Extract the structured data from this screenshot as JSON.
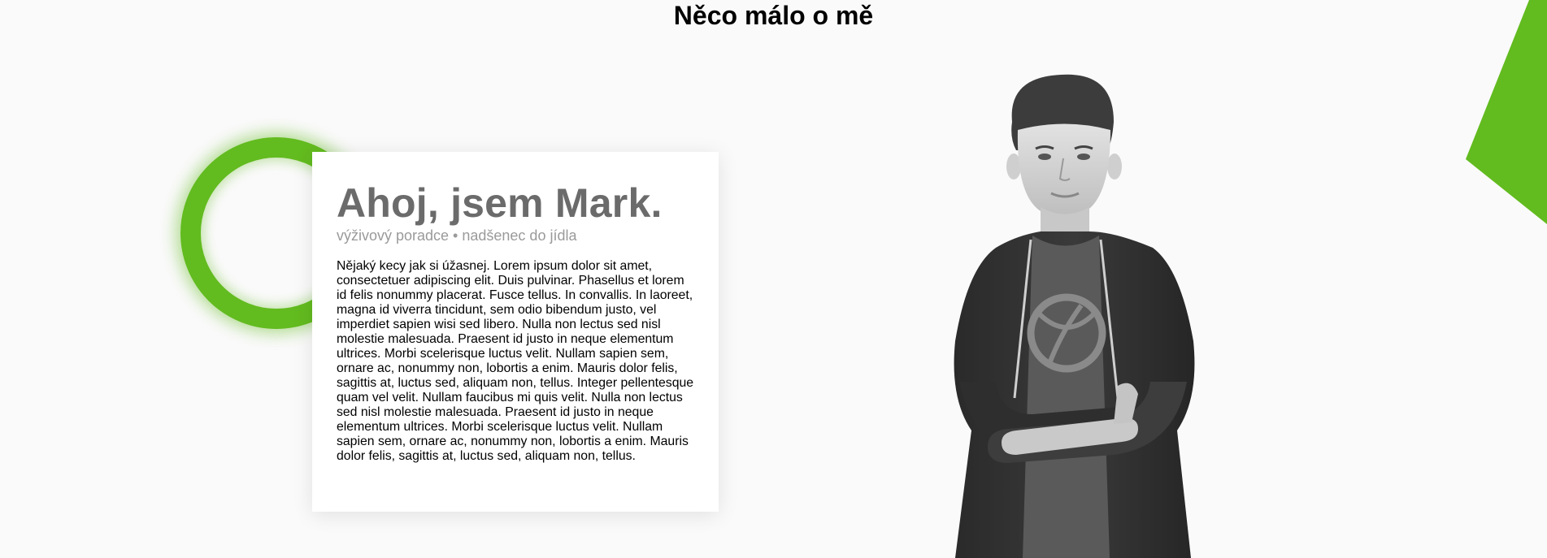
{
  "section": {
    "title": "Něco málo o mě"
  },
  "card": {
    "heading": "Ahoj, jsem Mark.",
    "subtitle": "výživový poradce • nadšenec do jídla",
    "body": "Nějaký kecy jak si úžasnej. Lorem ipsum dolor sit amet, consectetuer adipiscing elit. Duis pulvinar. Phasellus et lorem id felis nonummy placerat. Fusce tellus. In convallis. In laoreet, magna id viverra tincidunt, sem odio bibendum justo, vel imperdiet sapien wisi sed libero. Nulla non lectus sed nisl molestie malesuada. Praesent id justo in neque elementum ultrices. Morbi scelerisque luctus velit. Nullam sapien sem, ornare ac, nonummy non, lobortis a enim. Mauris dolor felis, sagittis at, luctus sed, aliquam non, tellus. Integer pellentesque quam vel velit. Nullam faucibus mi quis velit. Nulla non lectus sed nisl molestie malesuada. Praesent id justo in neque elementum ultrices. Morbi scelerisque luctus velit. Nullam sapien sem, ornare ac, nonummy non, lobortis a enim. Mauris dolor felis, sagittis at, luctus sed, aliquam non, tellus."
  },
  "colors": {
    "accent": "#62bb1f",
    "heading_gray": "#6b6b6b",
    "subtitle_gray": "#9a9a9a"
  },
  "decorations": {
    "ring": "green-circle-outline",
    "triangle": "green-triangle-shape",
    "portrait": "grayscale-portrait-photo"
  }
}
